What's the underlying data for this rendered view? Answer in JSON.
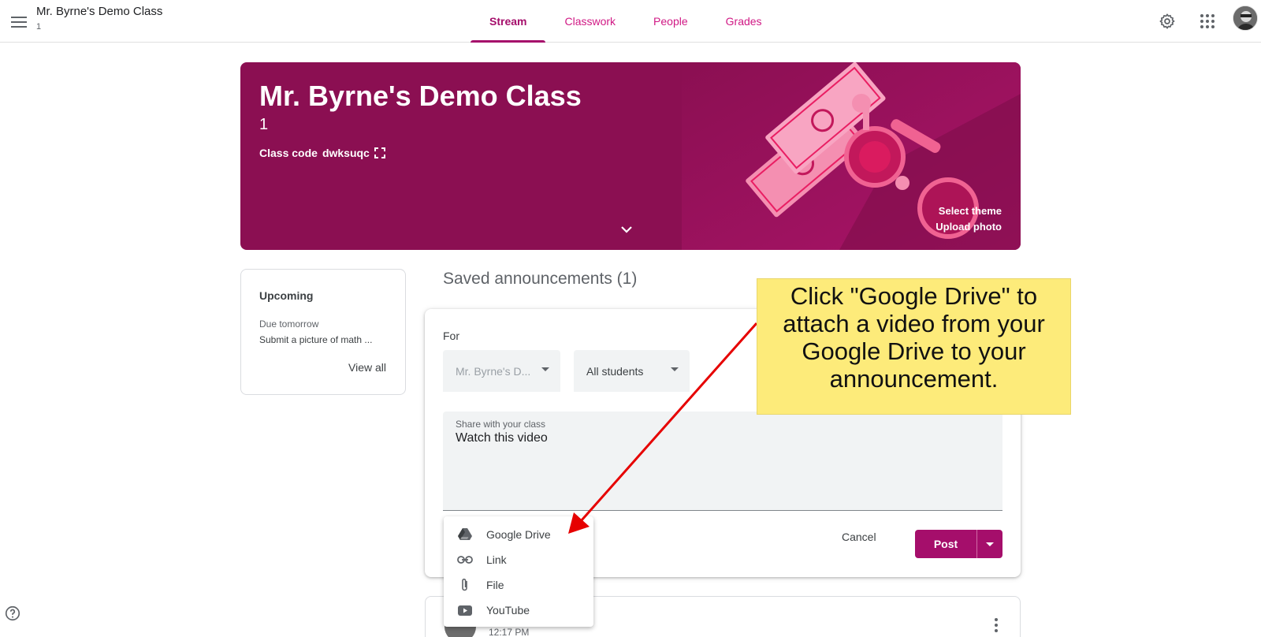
{
  "topbar": {
    "class_title": "Mr. Byrne's Demo Class",
    "class_section": "1",
    "tabs": [
      {
        "label": "Stream",
        "active": true
      },
      {
        "label": "Classwork",
        "active": false
      },
      {
        "label": "People",
        "active": false
      },
      {
        "label": "Grades",
        "active": false
      }
    ],
    "icons": [
      "menu-icon",
      "gear-icon",
      "apps-grid-icon",
      "avatar"
    ]
  },
  "banner": {
    "title": "Mr. Byrne's Demo Class",
    "section": "1",
    "class_code_label": "Class code",
    "class_code": "dwksuqc",
    "select_theme": "Select theme",
    "upload_photo": "Upload photo",
    "color": "#8b0f52"
  },
  "upcoming": {
    "heading": "Upcoming",
    "due_label": "Due tomorrow",
    "item": "Submit a picture of math ...",
    "view_all": "View all"
  },
  "stream": {
    "saved_title": "Saved announcements (1)",
    "compose": {
      "for_label": "For",
      "class_select": "Mr. Byrne's D...",
      "students_select": "All students",
      "text_label": "Share with your class",
      "text_value": "Watch this video",
      "cancel": "Cancel",
      "post": "Post"
    },
    "attach_menu": [
      {
        "label": "Google Drive",
        "icon": "google-drive-icon"
      },
      {
        "label": "Link",
        "icon": "link-icon"
      },
      {
        "label": "File",
        "icon": "paperclip-icon"
      },
      {
        "label": "YouTube",
        "icon": "youtube-icon"
      }
    ],
    "next_post_time": "12:17 PM"
  },
  "callout": {
    "text": "Click \"Google Drive\" to attach a video from your Google Drive to your announcement.",
    "color": "#fdeb7a",
    "arrow_color": "#e60000"
  },
  "accent_color": "#a50e6b"
}
